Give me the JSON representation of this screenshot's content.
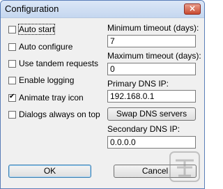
{
  "window": {
    "title": "Configuration",
    "close_glyph": "×"
  },
  "options": [
    {
      "label": "Auto start",
      "checked": false
    },
    {
      "label": "Auto configure",
      "checked": false
    },
    {
      "label": "Use tandem requests",
      "checked": false
    },
    {
      "label": "Enable logging",
      "checked": false
    },
    {
      "label": "Animate tray icon",
      "checked": true
    },
    {
      "label": "Dialogs always on top",
      "checked": false
    }
  ],
  "fields": {
    "min_timeout": {
      "label": "Minimum timeout (days):",
      "value": "7"
    },
    "max_timeout": {
      "label": "Maximum timeout (days):",
      "value": "0"
    },
    "primary_dns": {
      "label": "Primary DNS IP:",
      "value": "192.168.0.1"
    },
    "swap_dns_label": "Swap DNS servers",
    "secondary_dns": {
      "label": "Secondary DNS IP:",
      "value": "0.0.0.0"
    }
  },
  "buttons": {
    "ok": "OK",
    "cancel": "Cancel"
  },
  "watermark": {
    "icon": "site-logo-icon"
  }
}
